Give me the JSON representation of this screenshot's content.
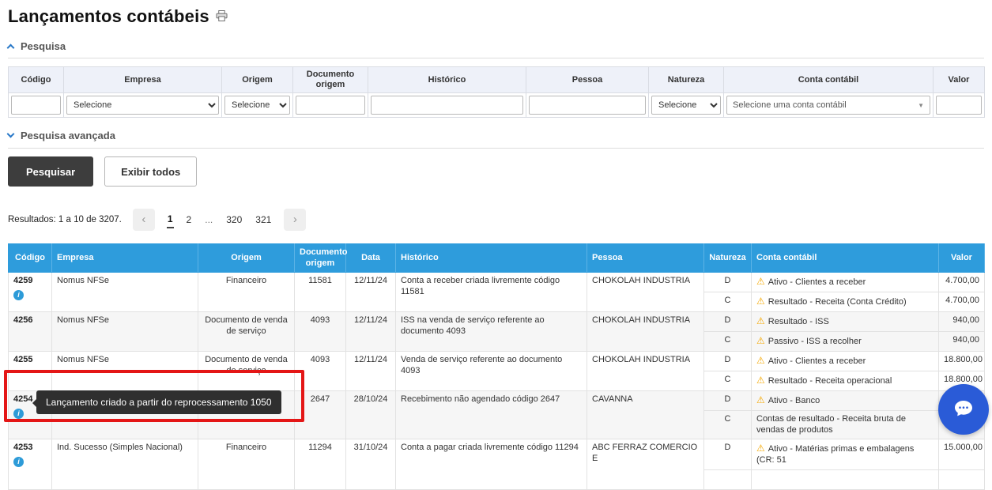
{
  "page": {
    "title": "Lançamentos contábeis"
  },
  "search": {
    "title": "Pesquisa",
    "advanced_title": "Pesquisa avançada",
    "buttons": {
      "search": "Pesquisar",
      "show_all": "Exibir todos"
    },
    "filters": {
      "headers": [
        "Código",
        "Empresa",
        "Origem",
        "Documento origem",
        "Histórico",
        "Pessoa",
        "Natureza",
        "Conta contábil",
        "Valor"
      ],
      "empresa_placeholder": "Selecione",
      "origem_placeholder": "Selecione",
      "natureza_placeholder": "Selecione",
      "conta_placeholder": "Selecione uma conta contábil"
    }
  },
  "results": {
    "summary": "Resultados: 1 a 10 de 3207.",
    "pagination": {
      "pages": [
        "1",
        "2",
        "...",
        "320",
        "321"
      ],
      "current_page": "1"
    }
  },
  "table": {
    "headers": [
      "Código",
      "Empresa",
      "Origem",
      "Documento origem",
      "Data",
      "Histórico",
      "Pessoa",
      "Natureza",
      "Conta contábil",
      "Valor"
    ],
    "rows": [
      {
        "codigo": "4259",
        "empresa": "Nomus NFSe",
        "origem": "Financeiro",
        "doc_origem": "11581",
        "data": "12/11/24",
        "historico": "Conta a receber criada livremente código 11581",
        "pessoa": "CHOKOLAH INDUSTRIA",
        "d": {
          "nat": "D",
          "conta": "Ativo - Clientes a receber",
          "valor": "4.700,00"
        },
        "c": {
          "nat": "C",
          "conta": "Resultado - Receita (Conta Crédito)",
          "valor": "4.700,00"
        }
      },
      {
        "codigo": "4256",
        "empresa": "Nomus NFSe",
        "origem": "Documento de venda de serviço",
        "doc_origem": "4093",
        "data": "12/11/24",
        "historico": "ISS na venda de serviço referente ao documento 4093",
        "pessoa": "CHOKOLAH INDUSTRIA",
        "d": {
          "nat": "D",
          "conta": "Resultado - ISS",
          "valor": "940,00"
        },
        "c": {
          "nat": "C",
          "conta": "Passivo - ISS a recolher",
          "valor": "940,00"
        }
      },
      {
        "codigo": "4255",
        "empresa": "Nomus NFSe",
        "origem": "Documento de venda de serviço",
        "doc_origem": "4093",
        "data": "12/11/24",
        "historico": "Venda de serviço referente ao documento 4093",
        "pessoa": "CHOKOLAH INDUSTRIA",
        "d": {
          "nat": "D",
          "conta": "Ativo - Clientes a receber",
          "valor": "18.800,00"
        },
        "c": {
          "nat": "C",
          "conta": "Resultado - Receita operacional",
          "valor": "18.800,00"
        }
      },
      {
        "codigo": "4254",
        "empresa": "",
        "origem": "",
        "doc_origem": "2647",
        "data": "28/10/24",
        "historico": "Recebimento não agendado código 2647",
        "pessoa": "CAVANNA",
        "d": {
          "nat": "D",
          "conta": "Ativo - Banco",
          "valor": ""
        },
        "c": {
          "nat": "C",
          "conta": "Contas de resultado - Receita bruta de vendas de produtos",
          "valor": ""
        }
      },
      {
        "codigo": "4253",
        "empresa": "Ind. Sucesso (Simples Nacional)",
        "origem": "Financeiro",
        "doc_origem": "11294",
        "data": "31/10/24",
        "historico": "Conta a pagar criada livremente código 11294",
        "pessoa": "ABC FERRAZ COMERCIO E",
        "d": {
          "nat": "D",
          "conta": "Ativo - Matérias primas e embalagens (CR: 51",
          "valor": "15.000,00"
        },
        "c": {
          "nat": "",
          "conta": "",
          "valor": ""
        }
      }
    ]
  },
  "tooltip": {
    "text": "Lançamento criado a partir do reprocessamento 1050"
  },
  "icons": {
    "info": "i",
    "warning": "⚠",
    "prev": "‹",
    "next": "›",
    "dropdown": "▼"
  },
  "colors": {
    "table_header": "#2e9cdc",
    "chat_button": "#2a5bd7",
    "annotation_box": "#e41616",
    "warning": "#f5a800",
    "info": "#2d9bd8",
    "search_button": "#3d3d3d"
  }
}
